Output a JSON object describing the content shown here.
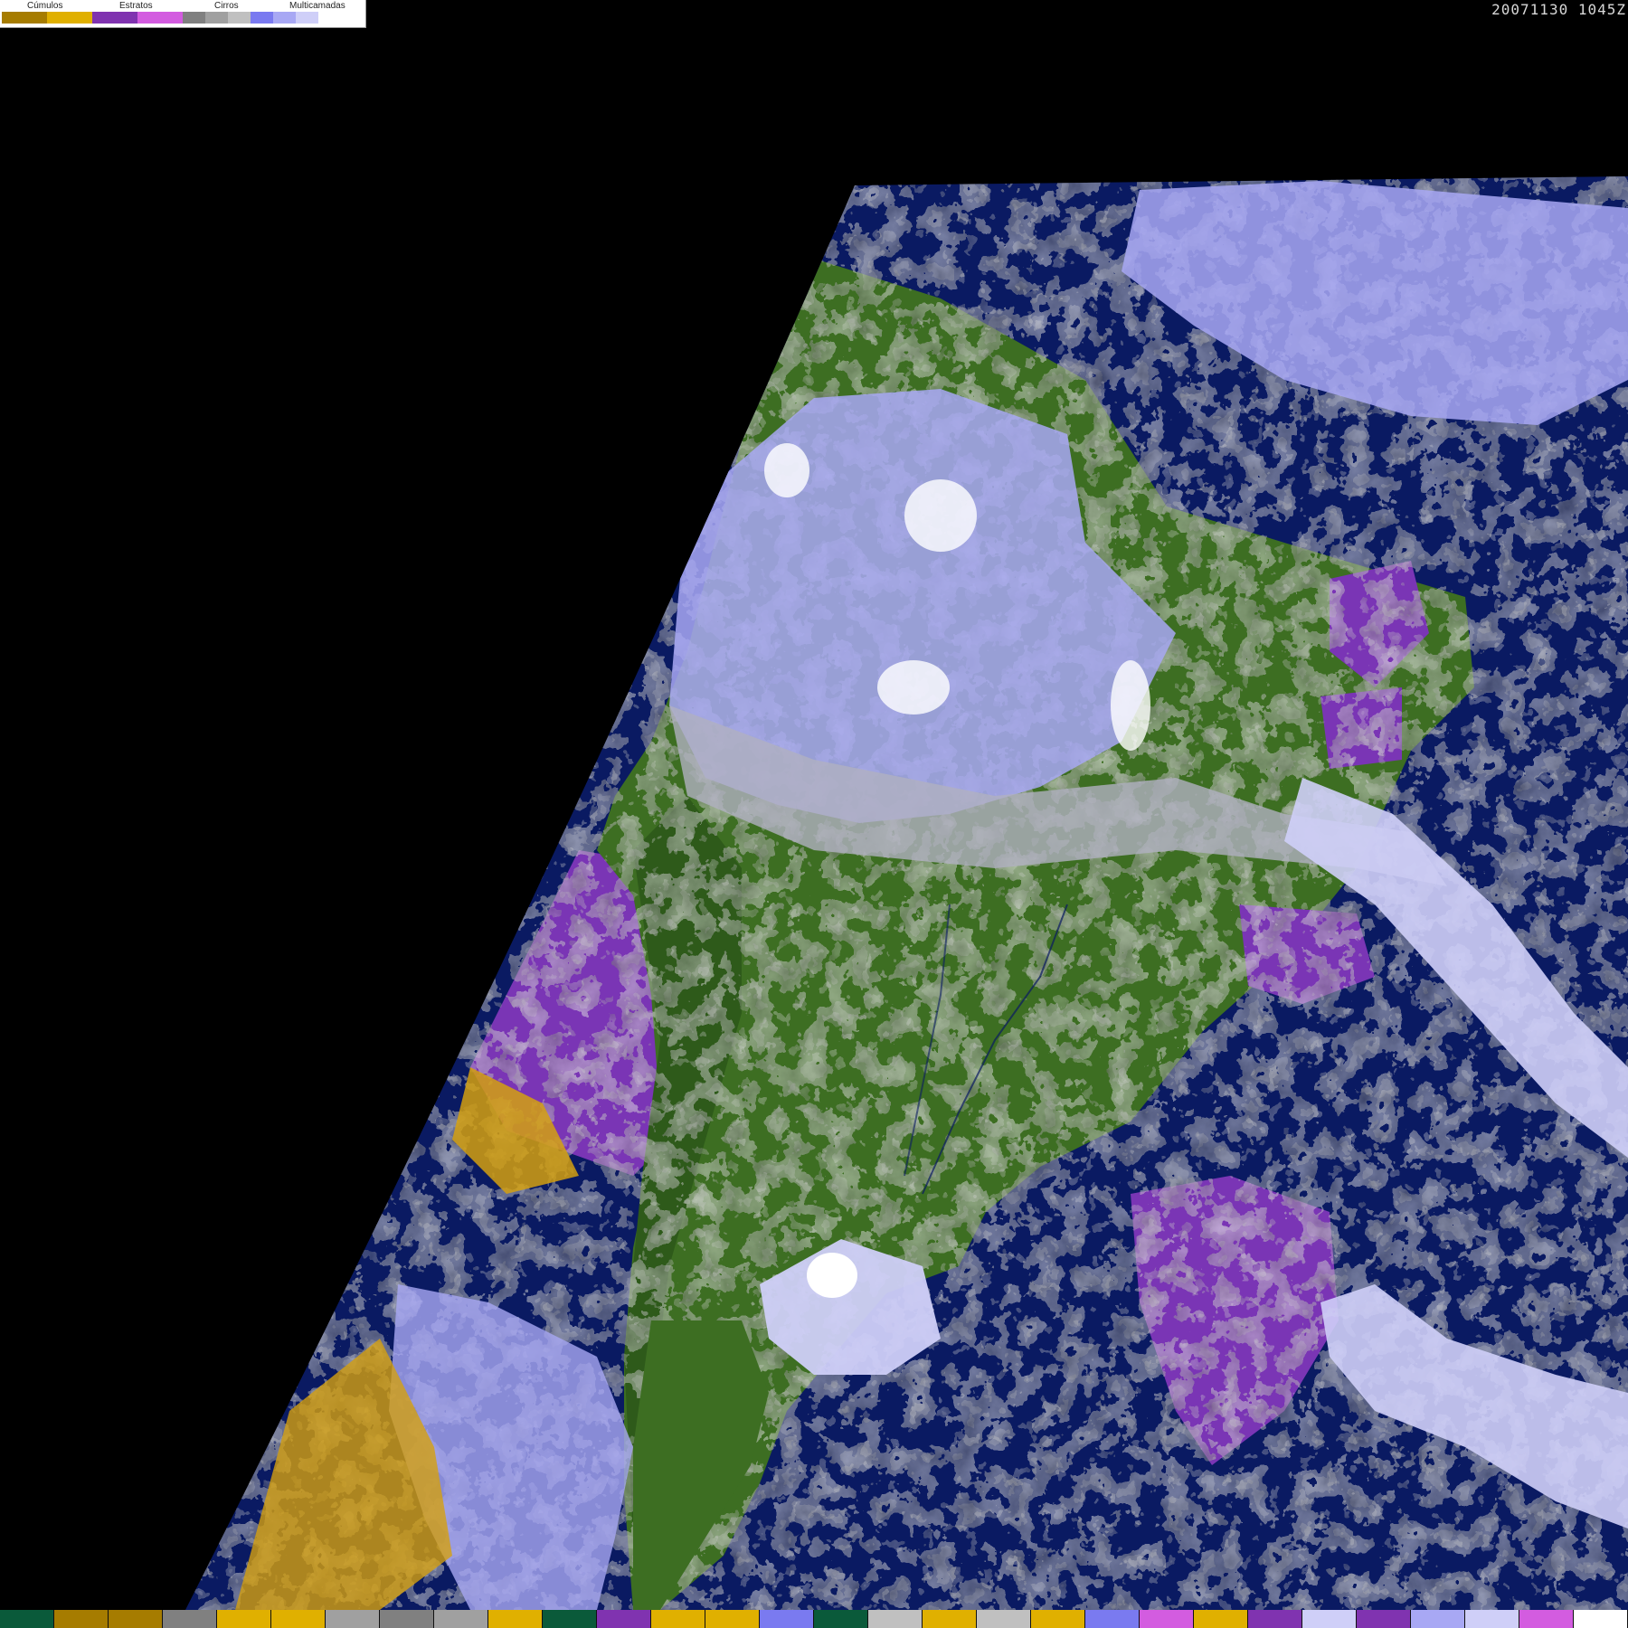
{
  "timestamp": "20071130 1045Z",
  "legend": {
    "categories": [
      {
        "label": "Cúmulos",
        "colors": [
          "#a67c00",
          "#e0b000"
        ]
      },
      {
        "label": "Estratos",
        "colors": [
          "#8033b0",
          "#d35ce0"
        ]
      },
      {
        "label": "Cirros",
        "colors": [
          "#808080",
          "#a0a0a0",
          "#c0c0c0"
        ]
      },
      {
        "label": "Multicamadas",
        "colors": [
          "#7a7af0",
          "#a8a8f4",
          "#cfcff8",
          "#ffffff"
        ]
      }
    ]
  },
  "colors": {
    "ocean": "#0a1a62",
    "land": "#3d6e22",
    "land_dark": "#2e5a1a",
    "cumulus": "#d4a010",
    "stratus": "#7a35b5",
    "cirrus": "#b0b0c0",
    "multilayer": "#c8c8f8",
    "background": "#000000"
  },
  "bottom_bar": {
    "colors": [
      "#0a5a3a",
      "#a67c00",
      "#a67c00",
      "#808080",
      "#e0b000",
      "#e0b000",
      "#a0a0a0",
      "#808080",
      "#a0a0a0",
      "#e0b000",
      "#0a5a3a",
      "#8033b0",
      "#e0b000",
      "#e0b000",
      "#7a7af0",
      "#0a5a3a",
      "#c0c0c0",
      "#e0b000",
      "#c0c0c0",
      "#e0b000",
      "#7a7af0",
      "#d35ce0",
      "#e0b000",
      "#8033b0",
      "#cfcff8",
      "#8033b0",
      "#a8a8f4",
      "#cfcff8",
      "#d35ce0",
      "#ffffff"
    ]
  }
}
